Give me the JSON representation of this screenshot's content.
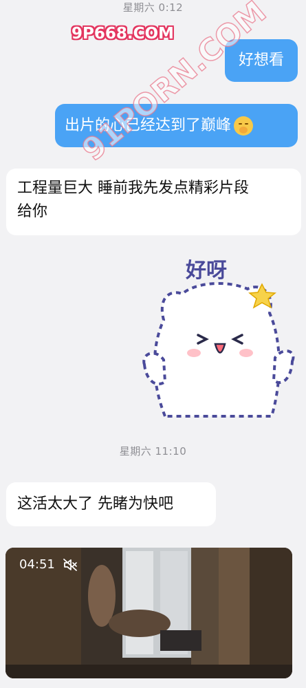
{
  "timestamps": [
    "星期六 0:12",
    "星期六 11:10"
  ],
  "watermarks": {
    "logo": "9P668.COM",
    "diagonal": "91PORN.COM"
  },
  "messages": {
    "out1": "好想看",
    "out2": "出片的心已经达到了巅峰",
    "in1_line1": "工程量巨大 睡前我先发点精彩片段",
    "in1_line2": "给你",
    "in2": "这活太大了 先睹为快吧"
  },
  "sticker": {
    "text": "好呀"
  },
  "video": {
    "duration": "04:51",
    "icon": "mute-icon"
  },
  "colors": {
    "outgoing_bubble": "#4aa3f5",
    "incoming_bubble": "#ffffff",
    "background": "#f2f2f4"
  }
}
